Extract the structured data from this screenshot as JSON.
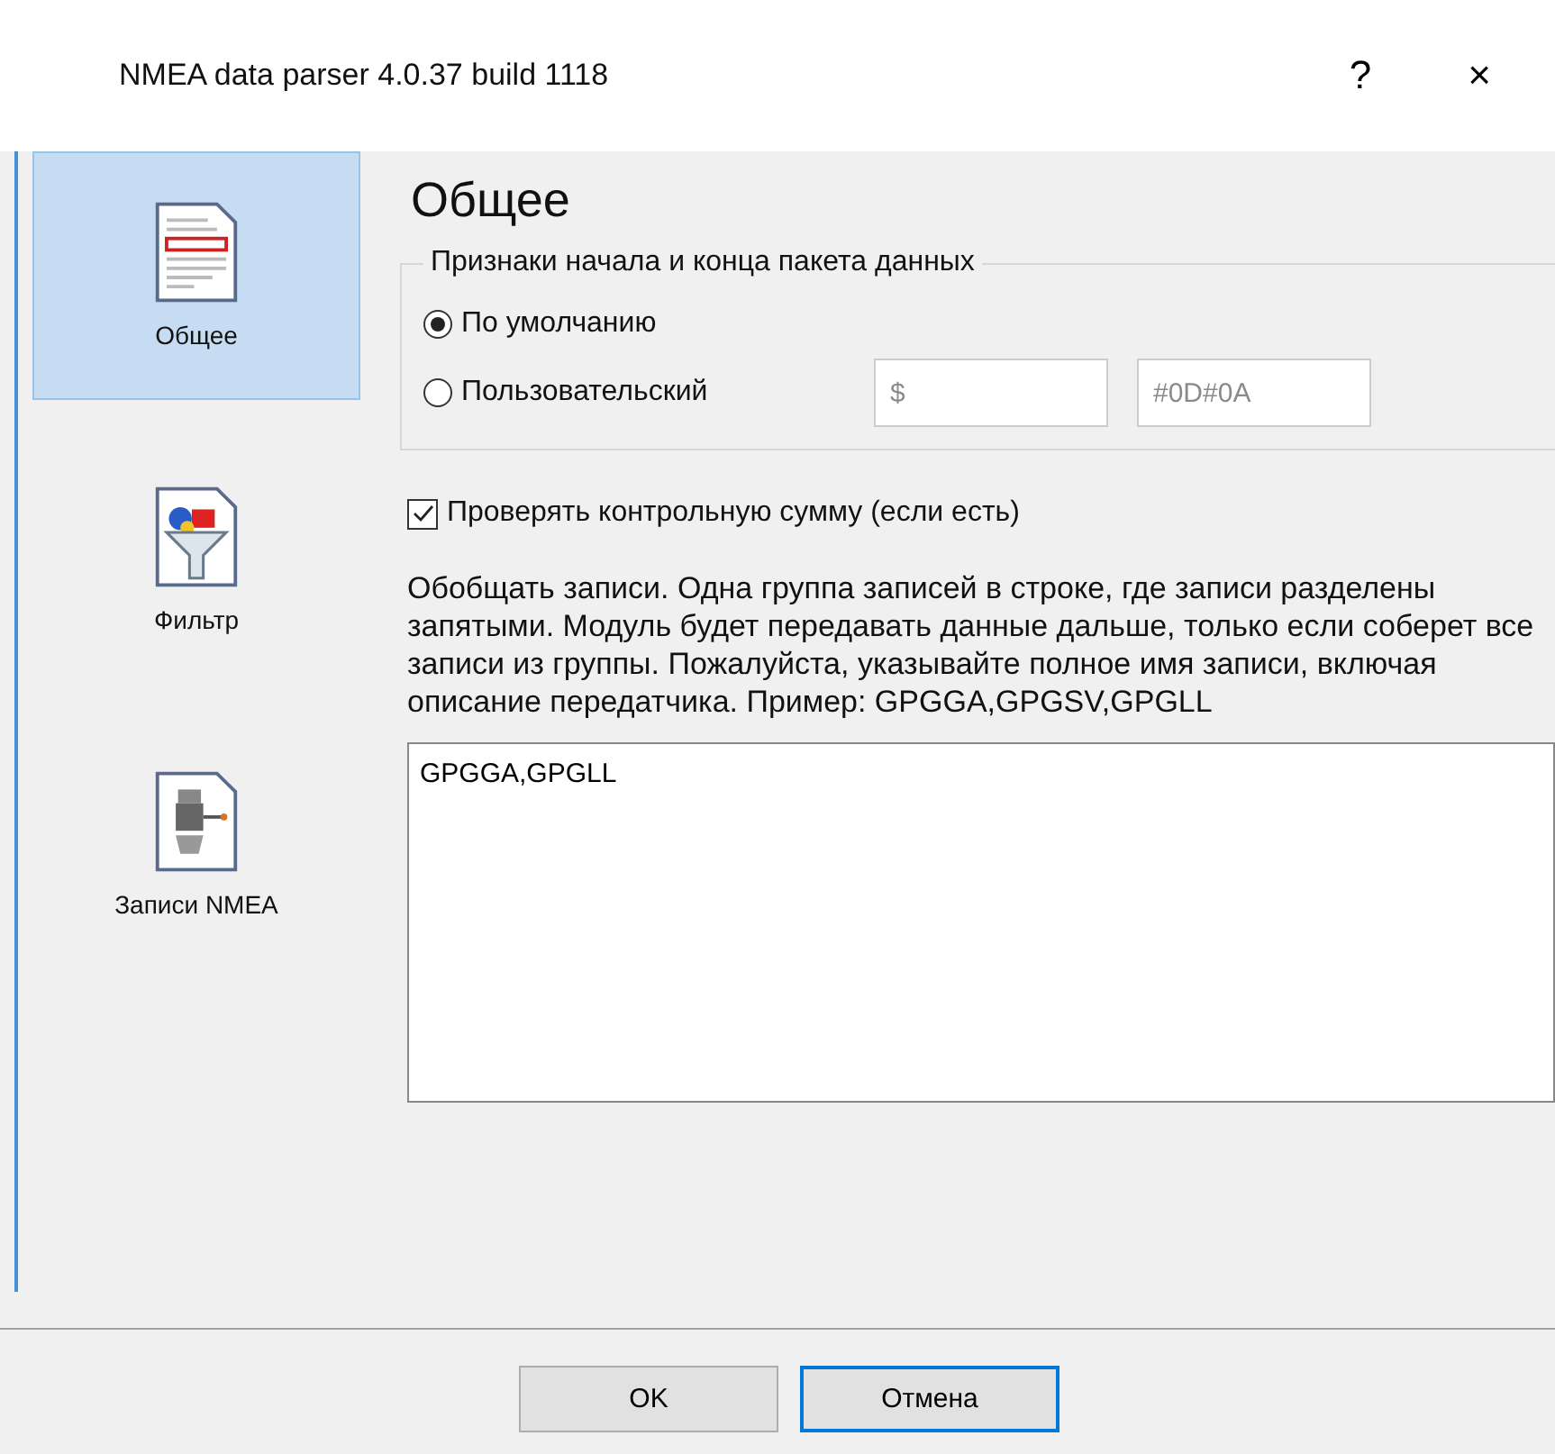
{
  "window": {
    "title": "NMEA data parser 4.0.37 build 1118",
    "help": "?",
    "close": "×"
  },
  "sidebar": {
    "items": [
      {
        "label": "Общее",
        "kind": "document",
        "selected": true
      },
      {
        "label": "Фильтр",
        "kind": "filter",
        "selected": false
      },
      {
        "label": "Записи NMEA",
        "kind": "engine",
        "selected": false
      }
    ]
  },
  "page": {
    "title": "Общее",
    "group": {
      "title": "Признаки начала и конца пакета данных",
      "options": [
        {
          "label": "По умолчанию",
          "selected": true
        },
        {
          "label": "Пользовательский",
          "selected": false
        }
      ],
      "start_field": {
        "value": "$",
        "disabled": true
      },
      "end_field": {
        "value": "#0D#0A",
        "disabled": true
      }
    },
    "checksum": {
      "label": "Проверять контрольную сумму (если есть)",
      "checked": true
    },
    "description": "Обобщать записи. Одна группа записей в строке, где записи разделены запятыми. Модуль будет передавать данные дальше, только если соберет все записи из группы. Пожалуйста, указывайте полное имя записи, включая описание передатчика. Пример: GPGGA,GPGSV,GPGLL",
    "records": "GPGGA,GPGLL"
  },
  "buttons": [
    {
      "label": "OK",
      "focused": false
    },
    {
      "label": "Отмена",
      "focused": true
    }
  ]
}
